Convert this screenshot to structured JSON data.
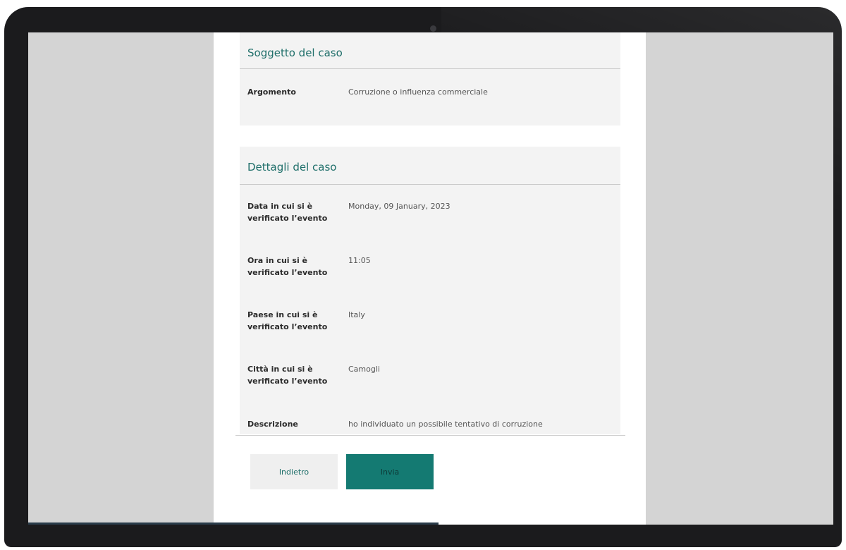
{
  "subject_section": {
    "title": "Soggetto del caso",
    "fields": [
      {
        "label": "Argomento",
        "value": "Corruzione o influenza commerciale"
      }
    ]
  },
  "details_section": {
    "title": "Dettagli del caso",
    "fields": [
      {
        "label": "Data in cui si è verificato l’evento",
        "value": "Monday, 09 January, 2023"
      },
      {
        "label": "Ora in cui si è verificato l’evento",
        "value": "11:05"
      },
      {
        "label": "Paese in cui si è verificato l’evento",
        "value": "Italy"
      },
      {
        "label": "Città in cui si è verificato l’evento",
        "value": "Camogli"
      },
      {
        "label": "Descrizione",
        "value": "ho individuato un possibile tentativo di corruzione"
      }
    ]
  },
  "actions": {
    "back_label": "Indietro",
    "send_label": "Invia"
  },
  "colors": {
    "accent": "#147a72",
    "title_text": "#1f6f6a",
    "card_background": "#f3f3f3",
    "screen_background": "#d4d4d4"
  }
}
